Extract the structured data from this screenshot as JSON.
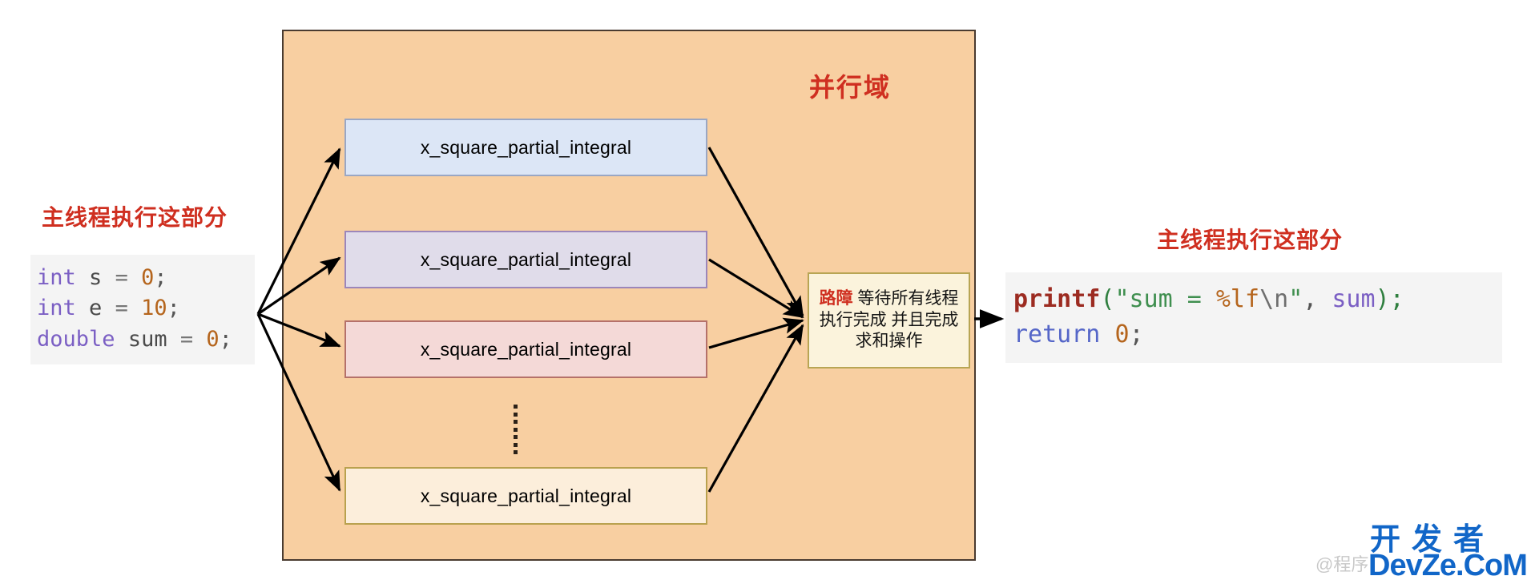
{
  "diagram": {
    "title_label": "并行域",
    "left_note": "主线程执行这部分",
    "right_note": "主线程执行这部分",
    "ellipsis_symbol": "⋮",
    "colors": {
      "parallel_region_fill": "#f8cfa1",
      "parallel_region_border": "#4a3b30",
      "accent_red": "#cf2f20",
      "barrier_fill": "#fbf3dc",
      "barrier_border": "#b8a554",
      "code_bg": "#f4f4f4",
      "arrow": "#000000",
      "watermark_blue": "#1166c8"
    }
  },
  "workers": [
    {
      "label": "x_square_partial_integral",
      "fill": "#dce6f6",
      "border": "#9aa7c4"
    },
    {
      "label": "x_square_partial_integral",
      "fill": "#e0dcea",
      "border": "#9c86ba"
    },
    {
      "label": "x_square_partial_integral",
      "fill": "#f4d9d7",
      "border": "#b5716a"
    },
    {
      "label": "x_square_partial_integral",
      "fill": "#fceedb",
      "border": "#b9a14e"
    }
  ],
  "barrier": {
    "keyword": "路障",
    "text": " 等待所有线程执行完成 并且完成求和操作",
    "full_text": "路障 等待所有线程执行完成 并且完成求和操作"
  },
  "code_left": {
    "lines": [
      {
        "tokens": [
          {
            "t": "int",
            "c": "t-kw"
          },
          {
            "t": " ",
            "c": "t-op"
          },
          {
            "t": "s",
            "c": "t-id"
          },
          {
            "t": " = ",
            "c": "t-op"
          },
          {
            "t": "0",
            "c": "t-num"
          },
          {
            "t": ";",
            "c": "t-punc"
          }
        ]
      },
      {
        "tokens": [
          {
            "t": "int",
            "c": "t-kw"
          },
          {
            "t": " ",
            "c": "t-op"
          },
          {
            "t": "e",
            "c": "t-id"
          },
          {
            "t": " = ",
            "c": "t-op"
          },
          {
            "t": "10",
            "c": "t-num"
          },
          {
            "t": ";",
            "c": "t-punc"
          }
        ]
      },
      {
        "tokens": [
          {
            "t": "double",
            "c": "t-kw"
          },
          {
            "t": " ",
            "c": "t-op"
          },
          {
            "t": "sum",
            "c": "t-id"
          },
          {
            "t": " = ",
            "c": "t-op"
          },
          {
            "t": "0",
            "c": "t-num"
          },
          {
            "t": ";",
            "c": "t-punc"
          }
        ]
      }
    ],
    "plain": "int s = 0;\nint e = 10;\ndouble sum = 0;"
  },
  "code_right": {
    "lines": [
      {
        "tokens": [
          {
            "t": "printf",
            "c": "t-fn"
          },
          {
            "t": "(",
            "c": "t-paren"
          },
          {
            "t": "\"",
            "c": "t-str"
          },
          {
            "t": "sum = ",
            "c": "t-str"
          },
          {
            "t": "%lf",
            "c": "t-fmt"
          },
          {
            "t": "\\n",
            "c": "t-esc"
          },
          {
            "t": "\"",
            "c": "t-str"
          },
          {
            "t": ", ",
            "c": "t-punc"
          },
          {
            "t": "sum",
            "c": "t-var"
          },
          {
            "t": ")",
            "c": "t-paren"
          },
          {
            "t": ";",
            "c": "t-paren"
          }
        ]
      },
      {
        "tokens": [
          {
            "t": "return",
            "c": "t-kw2"
          },
          {
            "t": " ",
            "c": "t-op"
          },
          {
            "t": "0",
            "c": "t-num"
          },
          {
            "t": ";",
            "c": "t-punc"
          }
        ]
      }
    ],
    "plain": "printf(\"sum = %lf\\n\", sum);\nreturn 0;"
  },
  "watermark": {
    "cn": "开发者",
    "en": "DevZe.CoM",
    "faint": "@程序"
  }
}
